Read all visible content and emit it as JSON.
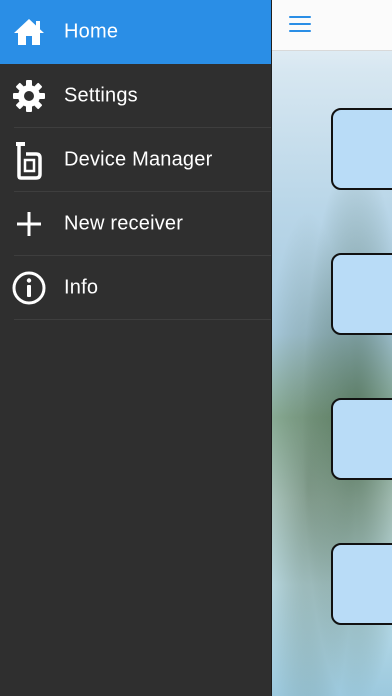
{
  "drawer": {
    "items": [
      {
        "label": "Home",
        "icon": "home-icon",
        "active": true
      },
      {
        "label": "Settings",
        "icon": "gear-icon",
        "active": false
      },
      {
        "label": "Device Manager",
        "icon": "device-manager-icon",
        "active": false
      },
      {
        "label": "New receiver",
        "icon": "plus-icon",
        "active": false
      },
      {
        "label": "Info",
        "icon": "info-icon",
        "active": false
      }
    ]
  },
  "header": {
    "menu_icon": "hamburger-icon"
  },
  "colors": {
    "accent": "#2a8ee6",
    "drawer_background": "#2f2f2f",
    "tile_fill": "#b9dcf7"
  }
}
